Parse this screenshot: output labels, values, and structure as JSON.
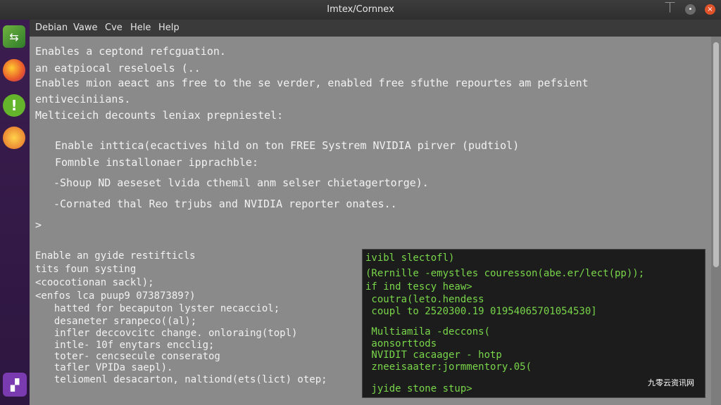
{
  "window": {
    "title": "Imtex/Cornnex"
  },
  "menu": [
    "Debian",
    "Vawe",
    "Cve",
    "Hele",
    "Help"
  ],
  "terminal_lines": [
    "Enables a ceptond refcguation.",
    "an eatpiocal reseloels (..",
    "Enables mion aeact ans free to the se verder, enabled free sfuthe repourtes am pefsient",
    "entiveciniians.",
    "Melticeich decounts leniax prepniestel:",
    "Enable inttica(ecactives hild on ton FREE Systrem NVIDIA pirver (pudtiol)",
    "Fomnble installonaer ipprachble:",
    "-Shoup ND aeseset lvida cthemil anm selser chietagertorge).",
    "-Cornated thal Reo trjubs and NVIDIA reporter onates..",
    ">"
  ],
  "lower_lines": [
    "Enable an gyide restifticls",
    "tits foun systing",
    "<coocotionan sackl);",
    "<enfos lca puup9 07387389?)",
    "  hatted for becaputon lyster necacciol;",
    "  desaneter sranpeco((al);",
    "  infler deccovcitc change. onloraing(topl)",
    "  intle- 10f enytars encclig;",
    "  toter- cencsecule conseratog",
    "  tafler VPIDa saepl).",
    "  teliomenl desacarton, naltiond(ets(lict) otep;"
  ],
  "inner_terminal": [
    "ivibl slectofl)",
    "(Rernille -emystles couresson(abe.er/lect(pp));",
    "if ind tescy heaw>",
    " coutra(leto.hendess",
    " coupl to 2520300.19 01954065701054530]",
    " Multiamila -deccons(",
    " aonsorttods",
    " NVIDIT cacaager - hotp",
    " zneeisaater:jormmentory.05(",
    " jyide stone stup>"
  ],
  "watermark": "九零云资讯网",
  "colors": {
    "terminal_bg": "#8a8a8a",
    "inner_text": "#79d64a",
    "launcher": "#3b1e4f"
  }
}
